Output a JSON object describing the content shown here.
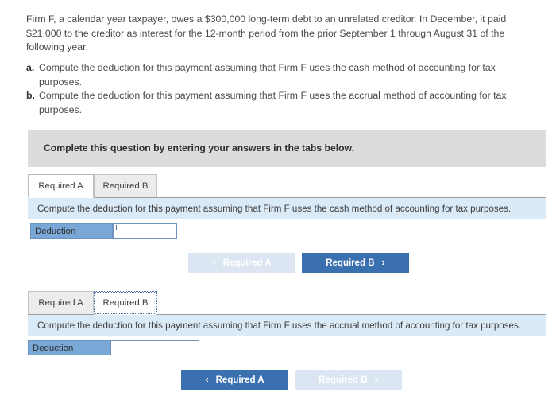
{
  "question": {
    "stem": "Firm F, a calendar year taxpayer, owes a $300,000 long-term debt to an unrelated creditor. In December, it paid $21,000 to the creditor as interest for the 12-month period from the prior September 1 through August 31 of the following year.",
    "parts": [
      {
        "marker": "a.",
        "text": "Compute the deduction for this payment assuming that Firm F uses the cash method of accounting for tax purposes."
      },
      {
        "marker": "b.",
        "text": "Compute the deduction for this payment assuming that Firm F uses the accrual method of accounting for tax purposes."
      }
    ]
  },
  "banner": {
    "text": "Complete this question by entering your answers in the tabs below."
  },
  "panels": [
    {
      "tabs": [
        {
          "label": "Required A",
          "state": "active"
        },
        {
          "label": "Required B",
          "state": "inactive"
        }
      ],
      "prompt": "Compute the deduction for this payment assuming that Firm F uses the cash method of accounting for tax purposes.",
      "answer": {
        "label": "Deduction",
        "value": "",
        "placeholder": ""
      },
      "nav": {
        "prev_label": "Required A",
        "prev_state": "disabled",
        "prev_icon": "chevron-left-icon",
        "next_label": "Required B",
        "next_state": "primary",
        "next_icon": "chevron-right-icon"
      }
    },
    {
      "tabs": [
        {
          "label": "Required A",
          "state": "inactive"
        },
        {
          "label": "Required B",
          "state": "active-focused"
        }
      ],
      "prompt": "Compute the deduction for this payment assuming that Firm F uses the accrual method of accounting for tax purposes.",
      "answer": {
        "label": "Deduction",
        "value": "",
        "placeholder": ""
      },
      "nav": {
        "prev_label": "Required A",
        "prev_state": "primary",
        "prev_icon": "chevron-left-icon",
        "next_label": "Required B",
        "next_state": "disabled",
        "next_icon": "chevron-right-icon"
      }
    }
  ],
  "icons": {
    "chevron_left": "‹",
    "chevron_right": "›"
  },
  "colors": {
    "primary_button": "#3a6fb0",
    "disabled_button": "#dce6f2",
    "banner_gray": "#dcdcdc",
    "prompt_blue": "#dbeaf7",
    "label_blue": "#7aa8d6"
  }
}
